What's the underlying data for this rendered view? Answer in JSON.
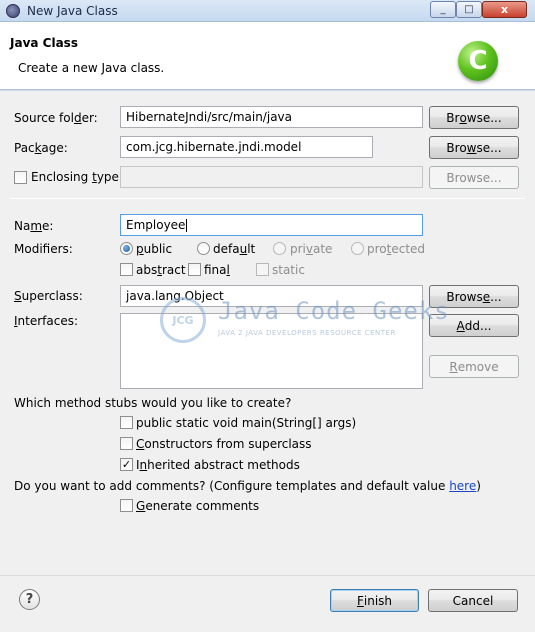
{
  "window": {
    "title": "New Java Class",
    "minimize": "_",
    "maximize": "□",
    "close": "x"
  },
  "header": {
    "title": "Java Class",
    "description": "Create a new Java class.",
    "logo_letter": "C"
  },
  "source_folder": {
    "label_pre": "Source fol",
    "label_ul": "d",
    "label_post": "er:",
    "value": "HibernateJndi/src/main/java",
    "browse_pre": "Br",
    "browse_ul": "o",
    "browse_post": "wse..."
  },
  "package": {
    "label_pre": "Pac",
    "label_ul": "k",
    "label_post": "age:",
    "value": "com.jcg.hibernate.jndi.model",
    "browse_pre": "Bro",
    "browse_ul": "w",
    "browse_post": "se..."
  },
  "enclosing_type": {
    "label_pre": "Enclosing ",
    "label_ul": "t",
    "label_post": "ype:",
    "value": "",
    "browse": "Browse..."
  },
  "name": {
    "label_pre": "Na",
    "label_ul": "m",
    "label_post": "e:",
    "value": "Employee"
  },
  "modifiers": {
    "label": "Modifiers:",
    "public_ul": "p",
    "public_post": "ublic",
    "default_pre": "defa",
    "default_ul": "u",
    "default_post": "lt",
    "private_pre": "pri",
    "private_ul": "v",
    "private_post": "ate",
    "protected_pre": "pro",
    "protected_ul": "t",
    "protected_post": "ected",
    "abstract_pre": "abs",
    "abstract_ul": "t",
    "abstract_post": "ract",
    "final_pre": "fina",
    "final_ul": "l",
    "static": "static",
    "selected": "public"
  },
  "superclass": {
    "label_ul": "S",
    "label_post": "uperclass:",
    "value": "java.lang.Object",
    "browse_pre": "Brows",
    "browse_ul": "e",
    "browse_post": "..."
  },
  "interfaces": {
    "label_ul": "I",
    "label_post": "nterfaces:",
    "add_ul": "A",
    "add_post": "dd...",
    "remove_ul": "R",
    "remove_post": "emove"
  },
  "watermark": {
    "badge": "JCG",
    "title": "Java Code Geeks",
    "subtitle": "JAVA 2 JAVA DEVELOPERS RESOURCE CENTER"
  },
  "method_stubs": {
    "question": "Which method stubs would you like to create?",
    "main": "public static void main(String[] args)",
    "constructors_ul": "C",
    "constructors_post": "onstructors from superclass",
    "inherited_pre": "I",
    "inherited_ul": "n",
    "inherited_post": "herited abstract methods",
    "inherited_checked": true,
    "check_mark": "✓"
  },
  "comments": {
    "question": "Do you want to add comments? (Configure templates and default value ",
    "link": "here",
    "close_paren": ")",
    "generate_ul": "G",
    "generate_post": "enerate comments"
  },
  "footer": {
    "help": "?",
    "finish_ul": "F",
    "finish_post": "inish",
    "cancel": "Cancel"
  }
}
